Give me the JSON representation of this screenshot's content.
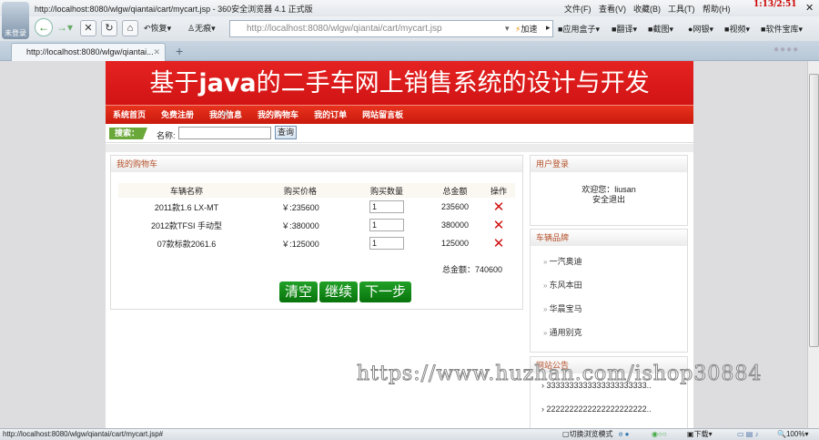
{
  "browser": {
    "window_title": "http://localhost:8080/wlgw/qiantai/cart/mycart.jsp - 360安全浏览器 4.1 正式版",
    "menu": [
      "文件(F)",
      "查看(V)",
      "收藏(B)",
      "工具(T)",
      "帮助(H)"
    ],
    "clock": "1:13/2:51",
    "avatar_label": "未登录",
    "restore_label": "恢复",
    "noscript_label": "无痕",
    "url": "http://localhost:8080/wlgw/qiantai/cart/mycart.jsp",
    "speed_label": "加速",
    "tools": [
      "应用盒子",
      "翻译",
      "截图",
      "网银",
      "视频",
      "软件宝库"
    ],
    "tab_title": "http://localhost:8080/wlgw/qiantai...",
    "status_url": "http://localhost:8080/wlgw/qiantai/cart/mycart.jsp#",
    "status_mode": "切换浏览模式",
    "status_download": "下载",
    "zoom": "100%"
  },
  "site": {
    "title_pre": "基于",
    "title_java": "java",
    "title_post": "的二手车网上销售系统的设计与开发",
    "nav": [
      "系统首页",
      "免费注册",
      "我的信息",
      "我的购物车",
      "我的订单",
      "网站留言板"
    ],
    "search": {
      "badge": "搜索：",
      "label": "名称:",
      "value": "",
      "button": "查询"
    }
  },
  "cart": {
    "title": "我的购物车",
    "headers": [
      "车辆名称",
      "购买价格",
      "购买数量",
      "总金额",
      "操作"
    ],
    "rows": [
      {
        "name": "2011款1.6 LX-MT",
        "price": "￥:235600",
        "qty": "1",
        "total": "235600"
      },
      {
        "name": "2012款TFSI 手动型",
        "price": "￥:380000",
        "qty": "1",
        "total": "380000"
      },
      {
        "name": "07款标款2061.6",
        "price": "￥:125000",
        "qty": "1",
        "total": "125000"
      }
    ],
    "grand_total_label": "总金额：",
    "grand_total": "740600",
    "buttons": [
      "清空",
      "继续",
      "下一步"
    ]
  },
  "sidebar": {
    "login": {
      "title": "用户登录",
      "welcome": "欢迎您：liusan",
      "logout": "安全退出"
    },
    "brands": {
      "title": "车辆品牌",
      "items": [
        "一汽奥迪",
        "东风本田",
        "华晨宝马",
        "通用别克"
      ]
    },
    "notices": {
      "title": "网站公告",
      "items": [
        "3333333333333333333333..",
        "2222222222222222222222.."
      ]
    }
  },
  "watermark": "https://www.huzhan.com/ishop30884"
}
